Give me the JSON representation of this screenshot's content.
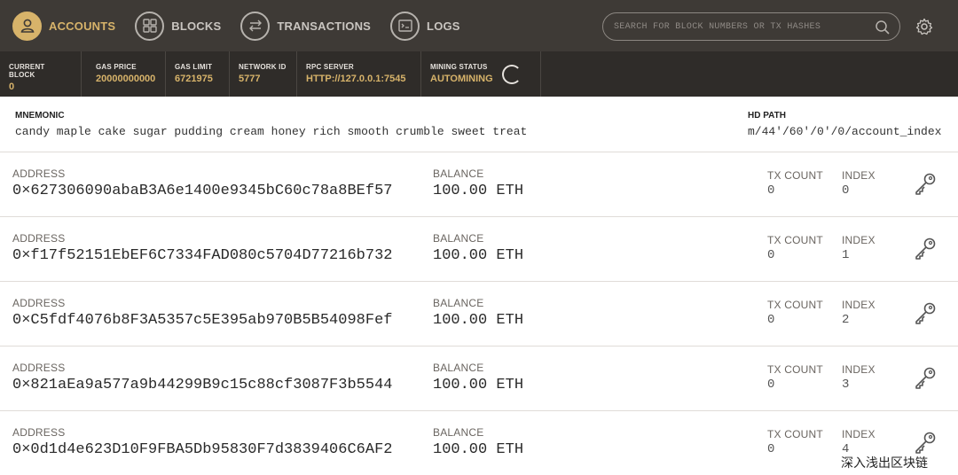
{
  "nav": {
    "items": [
      {
        "label": "ACCOUNTS",
        "icon": "person-icon",
        "active": true
      },
      {
        "label": "BLOCKS",
        "icon": "grid-icon",
        "active": false
      },
      {
        "label": "TRANSACTIONS",
        "icon": "swap-icon",
        "active": false
      },
      {
        "label": "LOGS",
        "icon": "log-icon",
        "active": false
      }
    ],
    "search_placeholder": "SEARCH FOR BLOCK NUMBERS OR TX HASHES"
  },
  "status": {
    "current_block": {
      "label": "CURRENT BLOCK",
      "value": "0"
    },
    "gas_price": {
      "label": "GAS PRICE",
      "value": "20000000000"
    },
    "gas_limit": {
      "label": "GAS LIMIT",
      "value": "6721975"
    },
    "network_id": {
      "label": "NETWORK ID",
      "value": "5777"
    },
    "rpc_server": {
      "label": "RPC SERVER",
      "value": "HTTP://127.0.0.1:7545"
    },
    "mining_status": {
      "label": "MINING STATUS",
      "value": "AUTOMINING"
    }
  },
  "mnemonic": {
    "label": "MNEMONIC",
    "value": "candy maple cake sugar pudding cream honey rich smooth crumble sweet treat",
    "hd_label": "HD PATH",
    "hd_value": "m/44'/60'/0'/0/account_index"
  },
  "labels": {
    "address": "ADDRESS",
    "balance": "BALANCE",
    "tx_count": "TX COUNT",
    "index": "INDEX"
  },
  "accounts": [
    {
      "address": "0×627306090abaB3A6e1400e9345bC60c78a8BEf57",
      "balance": "100.00 ETH",
      "tx_count": "0",
      "index": "0"
    },
    {
      "address": "0×f17f52151EbEF6C7334FAD080c5704D77216b732",
      "balance": "100.00 ETH",
      "tx_count": "0",
      "index": "1"
    },
    {
      "address": "0×C5fdf4076b8F3A5357c5E395ab970B5B54098Fef",
      "balance": "100.00 ETH",
      "tx_count": "0",
      "index": "2"
    },
    {
      "address": "0×821aEa9a577a9b44299B9c15c88cf3087F3b5544",
      "balance": "100.00 ETH",
      "tx_count": "0",
      "index": "3"
    },
    {
      "address": "0×0d1d4e623D10F9FBA5Db95830F7d3839406C6AF2",
      "balance": "100.00 ETH",
      "tx_count": "0",
      "index": "4"
    }
  ],
  "watermark": "深入浅出区块链",
  "colors": {
    "accent": "#d7b36a",
    "nav_bg": "#3e3a36",
    "status_bg": "#2f2c29"
  }
}
